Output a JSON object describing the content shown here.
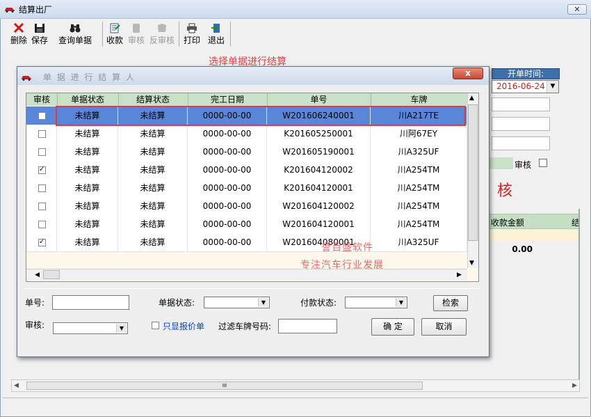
{
  "window": {
    "title": "结算出厂",
    "close_label": "✕"
  },
  "toolbar": {
    "buttons": [
      {
        "id": "delete",
        "label": "删除",
        "icon": "delete-x-icon",
        "enabled": true
      },
      {
        "id": "save",
        "label": "保存",
        "icon": "floppy-disk-icon",
        "enabled": true
      },
      {
        "id": "query",
        "label": "查询单据",
        "icon": "binoculars-icon",
        "enabled": true
      },
      {
        "id": "receive",
        "label": "收款",
        "icon": "receipt-icon",
        "enabled": true
      },
      {
        "id": "audit",
        "label": "审核",
        "icon": "audit-icon",
        "enabled": false
      },
      {
        "id": "unaudit",
        "label": "反审核",
        "icon": "unaudit-icon",
        "enabled": false
      },
      {
        "id": "print",
        "label": "打印",
        "icon": "printer-icon",
        "enabled": true
      },
      {
        "id": "exit",
        "label": "退出",
        "icon": "exit-door-icon",
        "enabled": true
      }
    ]
  },
  "annotation": {
    "text": "选择单据进行结算",
    "color": "#e64040"
  },
  "form": {
    "open_date_label": "开单时间:",
    "open_date_value": "2016-06-24",
    "audit_label": "审核",
    "big_char": "核",
    "grid_col_receive": "收款金额",
    "grid_col_more": "结",
    "total_value": "0.00",
    "scroll_grip": "III"
  },
  "dialog": {
    "ghost_title": "单 据 进 行   结 算 人",
    "close_label": "x",
    "columns": [
      "审核",
      "单据状态",
      "结算状态",
      "完工日期",
      "单号",
      "车牌"
    ],
    "rows": [
      {
        "audit": false,
        "doc_status": "未结算",
        "settle_status": "未结算",
        "finish_date": "0000-00-00",
        "doc_no": "W201606240001",
        "plate": "川A217TE",
        "selected": true
      },
      {
        "audit": false,
        "doc_status": "未结算",
        "settle_status": "未结算",
        "finish_date": "0000-00-00",
        "doc_no": "K201605250001",
        "plate": "川阿67EY",
        "selected": false
      },
      {
        "audit": false,
        "doc_status": "未结算",
        "settle_status": "未结算",
        "finish_date": "0000-00-00",
        "doc_no": "W201605190001",
        "plate": "川A325UF",
        "selected": false
      },
      {
        "audit": true,
        "doc_status": "未结算",
        "settle_status": "未结算",
        "finish_date": "0000-00-00",
        "doc_no": "K201604120002",
        "plate": "川A254TM",
        "selected": false
      },
      {
        "audit": false,
        "doc_status": "未结算",
        "settle_status": "未结算",
        "finish_date": "0000-00-00",
        "doc_no": "K201604120001",
        "plate": "川A254TM",
        "selected": false
      },
      {
        "audit": false,
        "doc_status": "未结算",
        "settle_status": "未结算",
        "finish_date": "0000-00-00",
        "doc_no": "W201604120002",
        "plate": "川A254TM",
        "selected": false
      },
      {
        "audit": false,
        "doc_status": "未结算",
        "settle_status": "未结算",
        "finish_date": "0000-00-00",
        "doc_no": "W201604120001",
        "plate": "川A254TM",
        "selected": false
      },
      {
        "audit": true,
        "doc_status": "未结算",
        "settle_status": "未结算",
        "finish_date": "0000-00-00",
        "doc_no": "W201604080001",
        "plate": "川A325UF",
        "selected": false
      }
    ],
    "watermark_line1": "誉百盛软件",
    "watermark_line2": "专注汽车行业发展",
    "filters": {
      "doc_no_label": "单号:",
      "doc_no_value": "",
      "doc_status_label": "单据状态:",
      "doc_status_value": "",
      "pay_status_label": "付款状态:",
      "pay_status_value": "",
      "search_button": "检索",
      "audit_label": "审核:",
      "audit_value": "",
      "only_quote_label": "只显报价单",
      "only_quote_checked": false,
      "plate_filter_label": "过滤车牌号码:",
      "plate_filter_value": "",
      "ok_button": "确 定",
      "cancel_button": "取消"
    }
  },
  "colors": {
    "header_green": "#c9e1c9",
    "selected_row": "#5a86d8",
    "highlight_red": "#e53a3a",
    "date_red": "#d02020",
    "link_blue": "#0b3fd6"
  }
}
